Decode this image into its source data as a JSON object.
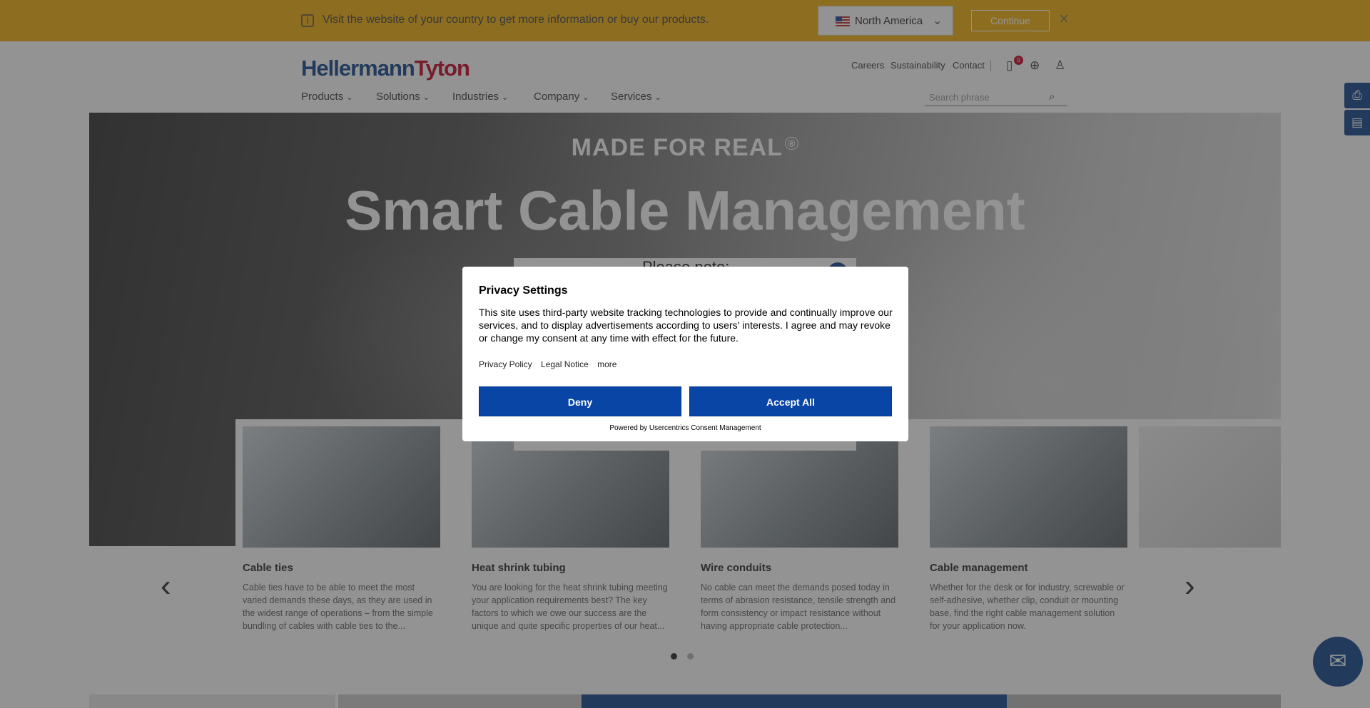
{
  "region_bar": {
    "message": "Visit the website of your country to get more information or buy our products.",
    "region": "North America",
    "continue_label": "Continue",
    "close_label": "×"
  },
  "header": {
    "logo_part1": "Hellermann",
    "logo_part2": "Tyton",
    "toplinks": [
      "Careers",
      "Sustainability",
      "Contact"
    ],
    "cart_count": "0",
    "nav": [
      "Products",
      "Solutions",
      "Industries",
      "Company",
      "Services"
    ],
    "search_placeholder": "Search phrase"
  },
  "hero": {
    "tagline": "MADE FOR REAL",
    "tagline_mark": "®",
    "headline": "Smart Cable Management"
  },
  "note_modal": {
    "title": "Please note:"
  },
  "cards": [
    {
      "title": "Cable ties",
      "description": "Cable ties have to be able to meet the most varied demands these days, as they are used in the widest range of operations – from the simple bundling of cables with cable ties to the..."
    },
    {
      "title": "Heat shrink tubing",
      "description": "You are looking for the heat shrink tubing meeting your application requirements best? The key factors to which we owe our success are the unique and quite specific properties of our heat..."
    },
    {
      "title": "Wire conduits",
      "description": "No cable can meet the demands posed today in terms of abrasion resistance, tensile strength and form consistency or impact resistance without having appropriate cable protection..."
    },
    {
      "title": "Cable management",
      "description": "Whether for the desk or for industry, screwable or self-adhesive, whether clip, conduit or mounting base, find the right cable management solution for your application now."
    }
  ],
  "privacy": {
    "title": "Privacy Settings",
    "body": "This site uses third-party website tracking technologies to provide and continually improve our services, and to display advertisements according to users' interests. I agree and may revoke or change my consent at any time with effect for the future.",
    "links": [
      "Privacy Policy",
      "Legal Notice",
      "more"
    ],
    "deny_label": "Deny",
    "accept_label": "Accept All",
    "powered_by": "Powered by Usercentrics Consent Management"
  },
  "colors": {
    "brand_blue": "#1d4f91",
    "brand_red": "#c8102e",
    "banner_yellow": "#f3b51a",
    "consent_button": "#0945a5"
  },
  "icons": {
    "info": "info-icon",
    "cart": "clipboard-icon",
    "globe": "globe-icon",
    "user": "user-icon",
    "search": "search-icon",
    "print": "print-icon",
    "notes": "notepad-icon",
    "chat": "chat-icon"
  }
}
